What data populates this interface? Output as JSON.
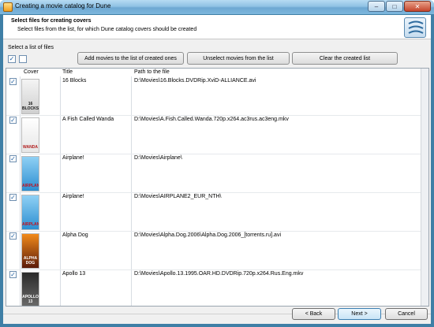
{
  "window": {
    "title": "Creating a movie catalog for Dune",
    "minimize": "–",
    "maximize": "□",
    "close": "✕"
  },
  "header": {
    "title": "Select files for creating covers",
    "subtitle": "Select files from the list, for which Dune catalog covers should be created"
  },
  "toolbar": {
    "select_label": "Select a list of files",
    "check_all": "✓",
    "check_none": "",
    "add_button": "Add movies to the list of created ones",
    "unselect_button": "Unselect movies from the list",
    "clear_button": "Clear the created list"
  },
  "grid": {
    "columns": [
      "Cover",
      "Title",
      "Path to the file"
    ],
    "rows": [
      {
        "checked": "✓",
        "cover_text": "16 BLOCKS",
        "title": "16 Blocks",
        "path": "D:\\Movies\\16.Blocks.DVDRip.XviD-ALLIANCE.avi"
      },
      {
        "checked": "✓",
        "cover_text": "WANDA",
        "title": "A Fish Called Wanda",
        "path": "D:\\Movies\\A.Fish.Called.Wanda.720p.x264.ac3rus.ac3eng.mkv"
      },
      {
        "checked": "✓",
        "cover_text": "AIRPLANE!",
        "title": "Airplane!",
        "path": "D:\\Movies\\Airplane\\"
      },
      {
        "checked": "✓",
        "cover_text": "AIRPLANE!",
        "title": "Airplane!",
        "path": "D:\\Movies\\AIRPLANE2_EUR_NTH\\"
      },
      {
        "checked": "✓",
        "cover_text": "ALPHA DOG",
        "title": "Alpha Dog",
        "path": "D:\\Movies\\Alpha.Dog.2006\\Alpha.Dog.2006_[torrents.ru].avi"
      },
      {
        "checked": "✓",
        "cover_text": "APOLLO 13",
        "title": "Apollo 13",
        "path": "D:\\Movies\\Apollo.13.1995.OAR.HD.DVDRip.720p.x264.Rus.Eng.mkv"
      }
    ]
  },
  "footer": {
    "back": "< Back",
    "next": "Next >",
    "cancel": "Cancel"
  },
  "colors": {
    "titlebar": "#8fc2e4",
    "checkmark": "#1f5fa0"
  }
}
